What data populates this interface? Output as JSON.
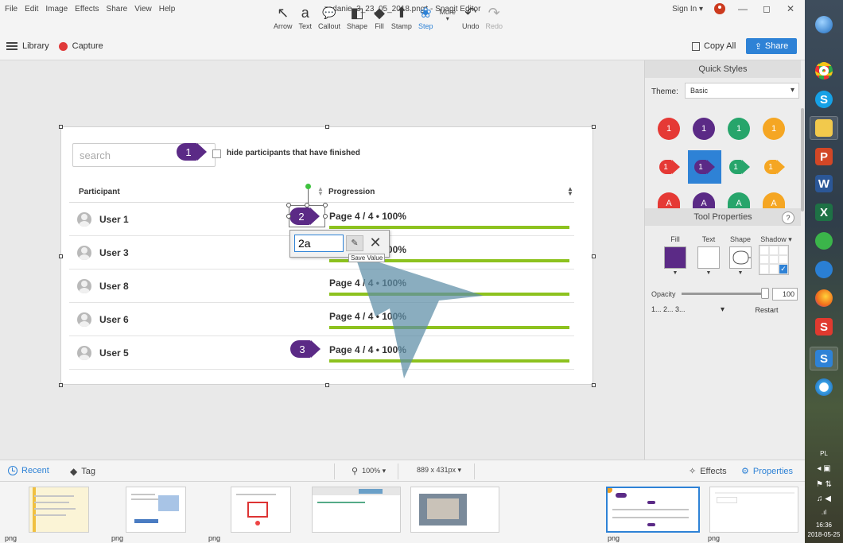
{
  "window": {
    "title": "zadanie_3_23_05_2018.png* - Snagit Editor",
    "menu": [
      "File",
      "Edit",
      "Image",
      "Effects",
      "Share",
      "View",
      "Help"
    ],
    "sign_in": "Sign In ▾",
    "controls": {
      "minimize": "—",
      "maximize": "◻",
      "close": "✕"
    }
  },
  "subbar": {
    "library": "Library",
    "capture": "Capture",
    "copy_all": "Copy All",
    "share": "Share"
  },
  "tools": [
    {
      "label": "Arrow",
      "icon": "↖"
    },
    {
      "label": "Text",
      "icon": "a"
    },
    {
      "label": "Callout",
      "icon": "💬"
    },
    {
      "label": "Shape",
      "icon": "◧"
    },
    {
      "label": "Fill",
      "icon": "◆"
    },
    {
      "label": "Stamp",
      "icon": "⬆"
    },
    {
      "label": "Step",
      "icon": "❀"
    },
    {
      "label": "More",
      "icon": "▾"
    },
    {
      "label": "Undo",
      "icon": "↶"
    },
    {
      "label": "Redo",
      "icon": "↷"
    }
  ],
  "active_tool": "Step",
  "document": {
    "search_placeholder": "search",
    "hide_label": "hide participants that have finished",
    "col_participant": "Participant",
    "col_progression": "Progression",
    "rows": [
      {
        "name": "User 1",
        "progress": "Page 4 / 4  •  100%",
        "fraction": 1.0
      },
      {
        "name": "User 3",
        "progress": "Page 4 / 4  •  100%",
        "fraction": 1.0
      },
      {
        "name": "User 8",
        "progress": "Page 4 / 4  •  100%",
        "fraction": 1.0
      },
      {
        "name": "User 6",
        "progress": "Page 4 / 4  •  100%",
        "fraction": 1.0
      },
      {
        "name": "User 5",
        "progress": "Page 4 / 4  •  100%",
        "fraction": 1.0
      }
    ]
  },
  "steps": [
    {
      "label": "1"
    },
    {
      "label": "2"
    },
    {
      "label": "3"
    }
  ],
  "step_edit": {
    "value": "2a",
    "tooltip": "Save Value",
    "save_icon": "✎",
    "close_icon": "✕"
  },
  "right_panel": {
    "quick_styles_title": "Quick Styles",
    "theme_label": "Theme:",
    "theme_value": "Basic",
    "quick_styles": {
      "colors": [
        "#e53935",
        "#5b2a86",
        "#27a56b",
        "#f5a623"
      ],
      "numbers": [
        "1",
        "1",
        "1",
        "1"
      ],
      "letters": [
        "A",
        "A",
        "A",
        "A"
      ]
    },
    "tool_props_title": "Tool Properties",
    "help_icon": "?",
    "fill_label": "Fill",
    "text_label": "Text",
    "shape_label": "Shape",
    "shadow_label": "Shadow ▾",
    "fill_color": "#5b2a86",
    "opacity_label": "Opacity",
    "opacity_value": "100",
    "numbering": "1... 2... 3...",
    "restart": "Restart"
  },
  "bottom_bar": {
    "recent": "Recent",
    "tag": "Tag",
    "zoom": "100% ▾",
    "size": "889 x 431px ▾",
    "effects": "Effects",
    "properties": "Properties"
  },
  "tray": {
    "labels": [
      "png",
      "png",
      "png",
      "png",
      "png"
    ]
  },
  "taskbar": {
    "lang": "PL",
    "time": "16:36",
    "date": "2018-05-25"
  },
  "colors": {
    "accent": "#2e82d6",
    "step": "#5b2a86",
    "progress": "#8dc21f"
  }
}
